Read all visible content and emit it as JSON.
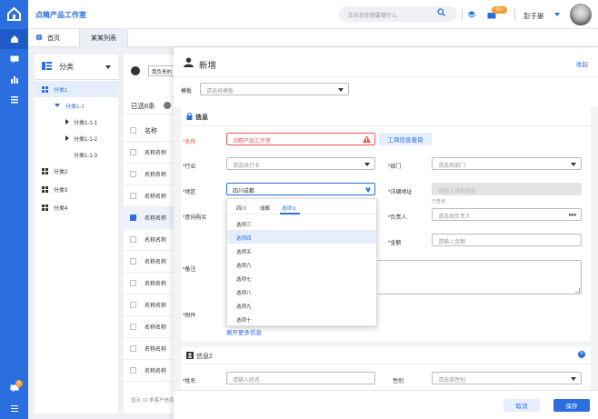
{
  "app": {
    "name": "点睛产品工作室",
    "search_placeholder": "告诉我你想要做什么",
    "badge": "99+",
    "user": "彭于晏",
    "notif_count": "5"
  },
  "tabs": [
    {
      "label": "首页"
    },
    {
      "label": "某某列表"
    }
  ],
  "tree": {
    "title": "分类",
    "items": [
      {
        "label": "分类1"
      },
      {
        "label": "分类1-1"
      },
      {
        "label": "分类1-1-1"
      },
      {
        "label": "分类1-1-2"
      },
      {
        "label": "分类1-1-3"
      },
      {
        "label": "分类2"
      },
      {
        "label": "分类3"
      },
      {
        "label": "分类4"
      }
    ]
  },
  "list": {
    "filter": "我负责的",
    "selected": "已选6条",
    "col": "名称",
    "row_text": "名称名称",
    "footer": "显示 12 条客户信息"
  },
  "form": {
    "title": "新增",
    "collapse": "收起",
    "template_label": "模板",
    "template_placeholder": "请选择模板",
    "section1": "信息",
    "section2": "信息2",
    "name_label": "*名称",
    "name_value": "点睛产品工作室",
    "name_btn": "工商信息查询",
    "industry_label": "*行业",
    "industry_ph": "请选择行业",
    "dept_label": "*部门",
    "dept_ph": "请选择部门",
    "region_label": "*地区",
    "region_value": "四川成都",
    "addr_label": "*详细地址",
    "addr_ph": "请输入详细地址",
    "addr_hint": "已查询",
    "intent_label": "*意向购买",
    "owner_label": "*负责人",
    "owner_ph": "请选择负责人",
    "amount_label": "*金额",
    "amount_ph": "请输入金额",
    "remark_label": "*备注",
    "attach_label": "*附件",
    "expand": "展开更多信息",
    "xm_label": "*姓名",
    "xm_ph": "请输入姓名",
    "sex_label": "性别",
    "sex_ph": "请选择性别"
  },
  "dropdown": {
    "tabs": [
      "四川",
      "成都",
      "选项②"
    ],
    "options": [
      "选项三",
      "选项四",
      "选项五",
      "选项六",
      "选项七",
      "选项八",
      "选项九",
      "选项十"
    ]
  },
  "buttons": {
    "cancel": "取消",
    "save": "保存"
  },
  "colors": {
    "primary": "#2a6ee0",
    "error": "#e55555"
  }
}
